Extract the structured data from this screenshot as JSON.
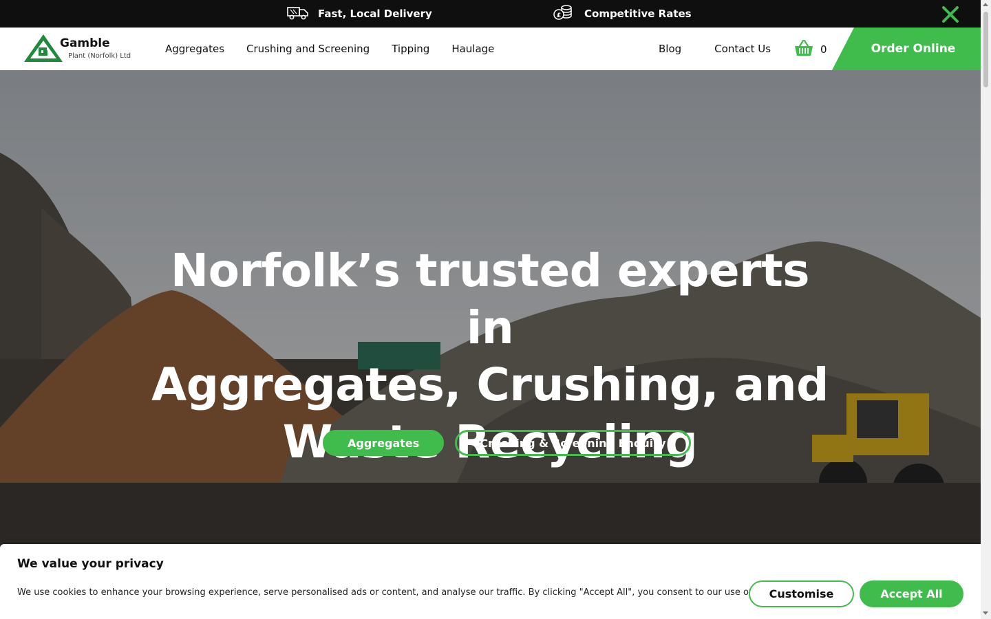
{
  "topbar": {
    "items": [
      {
        "label": "Fast, Local Delivery",
        "icon": "delivery-truck-icon"
      },
      {
        "label": "Competitive Rates",
        "icon": "coins-icon"
      }
    ],
    "close_icon": "close-icon"
  },
  "header": {
    "logo": {
      "name": "Gamble",
      "subtitle": "Plant (Norfolk) Ltd"
    },
    "nav_left": [
      "Aggregates",
      "Crushing and Screening",
      "Tipping",
      "Haulage"
    ],
    "nav_right": [
      "Blog",
      "Contact Us"
    ],
    "cart": {
      "icon": "basket-icon",
      "count": "0"
    },
    "order_button": "Order Online"
  },
  "hero": {
    "title_lines": [
      "Norfolk’s trusted experts in",
      "Aggregates, Crushing, and",
      "Waste Recycling"
    ],
    "primary_button": "Aggregates",
    "secondary_button": "Crushing & Screening Enquiry"
  },
  "cookie": {
    "title": "We value your privacy",
    "text": "We use cookies to enhance your browsing experience, serve personalised ads or content, and analyse our traffic. By clicking \"Accept All\", you consent to our use of cookies.",
    "customise": "Customise",
    "accept": "Accept All"
  },
  "colors": {
    "brand_green": "#3fbc4b",
    "topbar_bg": "#0f0f0f",
    "text_dark": "#111111"
  }
}
